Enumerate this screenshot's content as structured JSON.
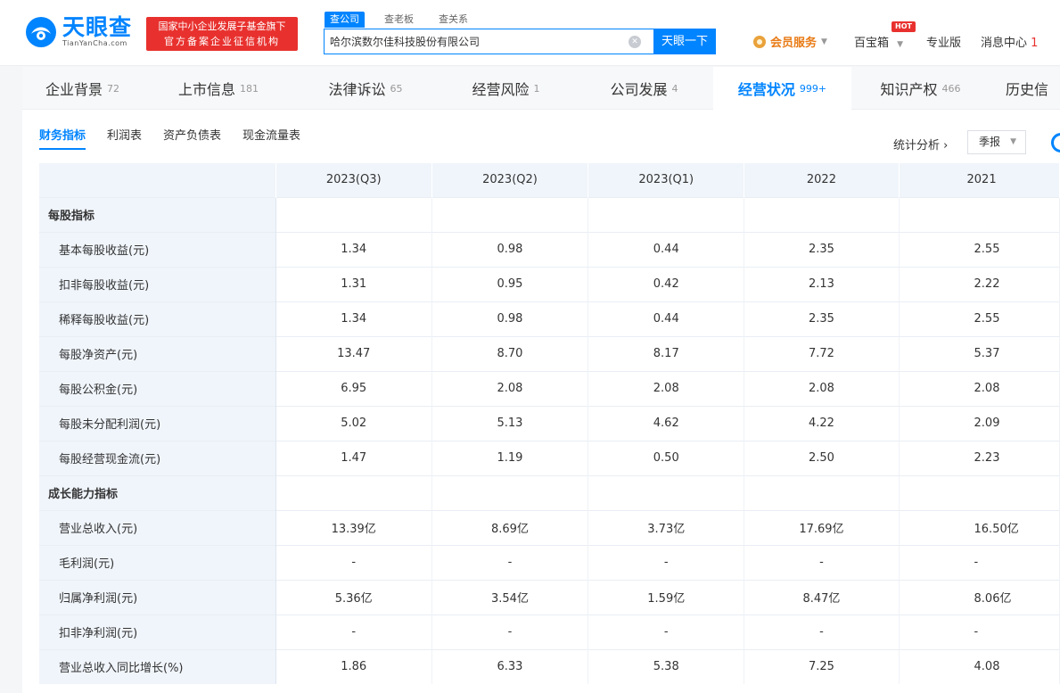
{
  "header": {
    "logo_cn": "天眼查",
    "logo_en": "TianYanCha.com",
    "badge_line1": "国家中小企业发展子基金旗下",
    "badge_line2": "官方备案企业征信机构",
    "search_tabs": [
      "查公司",
      "查老板",
      "查关系"
    ],
    "search_value": "哈尔滨数尔佳科技股份有限公司",
    "search_button": "天眼一下",
    "vip_label": "会员服务",
    "baobao": "百宝箱",
    "hot": "HOT",
    "pro": "专业版",
    "message": "消息中心",
    "message_count": "1"
  },
  "main_tabs": [
    {
      "label": "企业背景",
      "count": "72"
    },
    {
      "label": "上市信息",
      "count": "181"
    },
    {
      "label": "法律诉讼",
      "count": "65"
    },
    {
      "label": "经营风险",
      "count": "1"
    },
    {
      "label": "公司发展",
      "count": "4"
    },
    {
      "label": "经营状况",
      "count": "999+"
    },
    {
      "label": "知识产权",
      "count": "466"
    },
    {
      "label": "历史信",
      "count": ""
    }
  ],
  "sub_tabs": [
    "财务指标",
    "利润表",
    "资产负债表",
    "现金流量表"
  ],
  "stat_link": "统计分析",
  "period": "季报",
  "table": {
    "columns": [
      "2023(Q3)",
      "2023(Q2)",
      "2023(Q1)",
      "2022",
      "2021"
    ],
    "rows": [
      {
        "label": "每股指标",
        "section": true,
        "values": [
          "",
          "",
          "",
          "",
          ""
        ]
      },
      {
        "label": "基本每股收益(元)",
        "values": [
          "1.34",
          "0.98",
          "0.44",
          "2.35",
          "2.55"
        ]
      },
      {
        "label": "扣非每股收益(元)",
        "values": [
          "1.31",
          "0.95",
          "0.42",
          "2.13",
          "2.22"
        ]
      },
      {
        "label": "稀释每股收益(元)",
        "values": [
          "1.34",
          "0.98",
          "0.44",
          "2.35",
          "2.55"
        ]
      },
      {
        "label": "每股净资产(元)",
        "values": [
          "13.47",
          "8.70",
          "8.17",
          "7.72",
          "5.37"
        ]
      },
      {
        "label": "每股公积金(元)",
        "values": [
          "6.95",
          "2.08",
          "2.08",
          "2.08",
          "2.08"
        ]
      },
      {
        "label": "每股未分配利润(元)",
        "values": [
          "5.02",
          "5.13",
          "4.62",
          "4.22",
          "2.09"
        ]
      },
      {
        "label": "每股经营现金流(元)",
        "values": [
          "1.47",
          "1.19",
          "0.50",
          "2.50",
          "2.23"
        ]
      },
      {
        "label": "成长能力指标",
        "section": true,
        "values": [
          "",
          "",
          "",
          "",
          ""
        ]
      },
      {
        "label": "营业总收入(元)",
        "values": [
          "13.39亿",
          "8.69亿",
          "3.73亿",
          "17.69亿",
          "16.50亿"
        ]
      },
      {
        "label": "毛利润(元)",
        "values": [
          "-",
          "-",
          "-",
          "-",
          "-"
        ]
      },
      {
        "label": "归属净利润(元)",
        "values": [
          "5.36亿",
          "3.54亿",
          "1.59亿",
          "8.47亿",
          "8.06亿"
        ]
      },
      {
        "label": "扣非净利润(元)",
        "values": [
          "-",
          "-",
          "-",
          "-",
          "-"
        ]
      },
      {
        "label": "营业总收入同比增长(%)",
        "values": [
          "1.86",
          "6.33",
          "5.38",
          "7.25",
          "4.08"
        ]
      }
    ]
  }
}
